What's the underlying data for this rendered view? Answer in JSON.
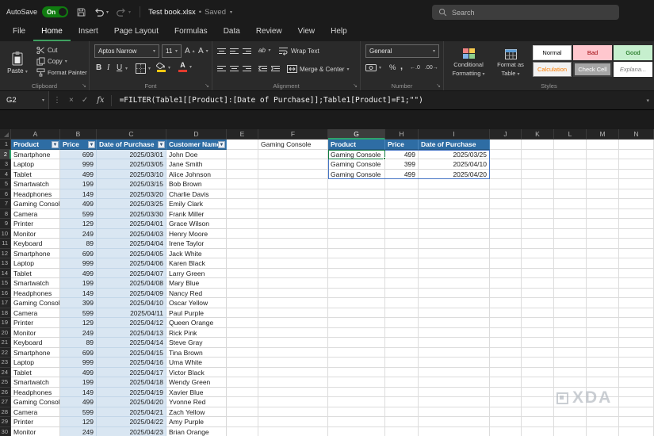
{
  "titlebar": {
    "autosave_label": "AutoSave",
    "autosave_state": "On",
    "doc_title": "Test book.xlsx",
    "doc_separator": "•",
    "doc_status": "Saved",
    "search_placeholder": "Search"
  },
  "menu": {
    "tabs": [
      "File",
      "Home",
      "Insert",
      "Page Layout",
      "Formulas",
      "Data",
      "Review",
      "View",
      "Help"
    ],
    "active": "Home"
  },
  "ribbon": {
    "clipboard": {
      "paste": "Paste",
      "cut": "Cut",
      "copy": "Copy",
      "format_painter": "Format Painter",
      "group": "Clipboard"
    },
    "font": {
      "font_name": "Aptos Narrow",
      "font_size": "11",
      "bold": "B",
      "italic": "I",
      "underline": "U",
      "grow": "A",
      "shrink": "A",
      "group": "Font"
    },
    "alignment": {
      "wrap_text": "Wrap Text",
      "merge_center": "Merge & Center",
      "orientation": "ab",
      "group": "Alignment"
    },
    "number": {
      "format": "General",
      "percent": "%",
      "comma": ",",
      "group": "Number"
    },
    "styles": {
      "conditional_formatting": [
        "Conditional",
        "Formatting"
      ],
      "format_as_table": [
        "Format as",
        "Table"
      ],
      "cells": [
        "Normal",
        "Bad",
        "Good",
        "Calculation",
        "Check Cell",
        "Explana..."
      ],
      "group": "Styles"
    },
    "icon_text": {
      "increase_decimal": "←.0",
      "decrease_decimal": ".00→",
      "launcher": "↘"
    }
  },
  "formula_bar": {
    "name_box": "G2",
    "fx": "fx",
    "formula": "=FILTER(Table1[[Product]:[Date of Purchase]];Table1[Product]=F1;\"\")"
  },
  "grid": {
    "column_letters": [
      "A",
      "B",
      "C",
      "D",
      "E",
      "F",
      "G",
      "H",
      "I",
      "J",
      "K",
      "L",
      "M",
      "N"
    ],
    "row_count": 30,
    "selected_column": "G",
    "selected_row": 2,
    "active_cell": "G2",
    "table": {
      "headers": [
        "Product",
        "Price",
        "Date of Purchase",
        "Customer Name"
      ],
      "rows": [
        [
          "Smartphone",
          "699",
          "2025/03/01",
          "John Doe"
        ],
        [
          "Laptop",
          "999",
          "2025/03/05",
          "Jane Smith"
        ],
        [
          "Tablet",
          "499",
          "2025/03/10",
          "Alice Johnson"
        ],
        [
          "Smartwatch",
          "199",
          "2025/03/15",
          "Bob Brown"
        ],
        [
          "Headphones",
          "149",
          "2025/03/20",
          "Charlie Davis"
        ],
        [
          "Gaming Console",
          "499",
          "2025/03/25",
          "Emily Clark"
        ],
        [
          "Camera",
          "599",
          "2025/03/30",
          "Frank Miller"
        ],
        [
          "Printer",
          "129",
          "2025/04/01",
          "Grace Wilson"
        ],
        [
          "Monitor",
          "249",
          "2025/04/03",
          "Henry Moore"
        ],
        [
          "Keyboard",
          "89",
          "2025/04/04",
          "Irene Taylor"
        ],
        [
          "Smartphone",
          "699",
          "2025/04/05",
          "Jack White"
        ],
        [
          "Laptop",
          "999",
          "2025/04/06",
          "Karen Black"
        ],
        [
          "Tablet",
          "499",
          "2025/04/07",
          "Larry Green"
        ],
        [
          "Smartwatch",
          "199",
          "2025/04/08",
          "Mary Blue"
        ],
        [
          "Headphones",
          "149",
          "2025/04/09",
          "Nancy Red"
        ],
        [
          "Gaming Console",
          "399",
          "2025/04/10",
          "Oscar Yellow"
        ],
        [
          "Camera",
          "599",
          "2025/04/11",
          "Paul Purple"
        ],
        [
          "Printer",
          "129",
          "2025/04/12",
          "Queen Orange"
        ],
        [
          "Monitor",
          "249",
          "2025/04/13",
          "Rick Pink"
        ],
        [
          "Keyboard",
          "89",
          "2025/04/14",
          "Steve Gray"
        ],
        [
          "Smartphone",
          "699",
          "2025/04/15",
          "Tina Brown"
        ],
        [
          "Laptop",
          "999",
          "2025/04/16",
          "Uma White"
        ],
        [
          "Tablet",
          "499",
          "2025/04/17",
          "Victor Black"
        ],
        [
          "Smartwatch",
          "199",
          "2025/04/18",
          "Wendy Green"
        ],
        [
          "Headphones",
          "149",
          "2025/04/19",
          "Xavier Blue"
        ],
        [
          "Gaming Console",
          "499",
          "2025/04/20",
          "Yvonne Red"
        ],
        [
          "Camera",
          "599",
          "2025/04/21",
          "Zach Yellow"
        ],
        [
          "Printer",
          "129",
          "2025/04/22",
          "Amy Purple"
        ],
        [
          "Monitor",
          "249",
          "2025/04/23",
          "Brian Orange"
        ]
      ]
    },
    "criteria": {
      "cell": "F1",
      "value": "Gaming Console"
    },
    "result": {
      "headers": [
        "Product",
        "Price",
        "Date of Purchase"
      ],
      "rows": [
        [
          "Gaming Console",
          "499",
          "2025/03/25"
        ],
        [
          "Gaming Console",
          "399",
          "2025/04/10"
        ],
        [
          "Gaming Console",
          "499",
          "2025/04/20"
        ]
      ]
    }
  },
  "watermark": {
    "text": "XDA"
  },
  "colors": {
    "table_header": "#2e6da4",
    "banded_fill": "#d9e6f2",
    "spill_border": "#4574c4",
    "selection": "#107c41",
    "autosave_on": "#107c10",
    "bad": "#ffc7ce",
    "good": "#c6efce"
  }
}
